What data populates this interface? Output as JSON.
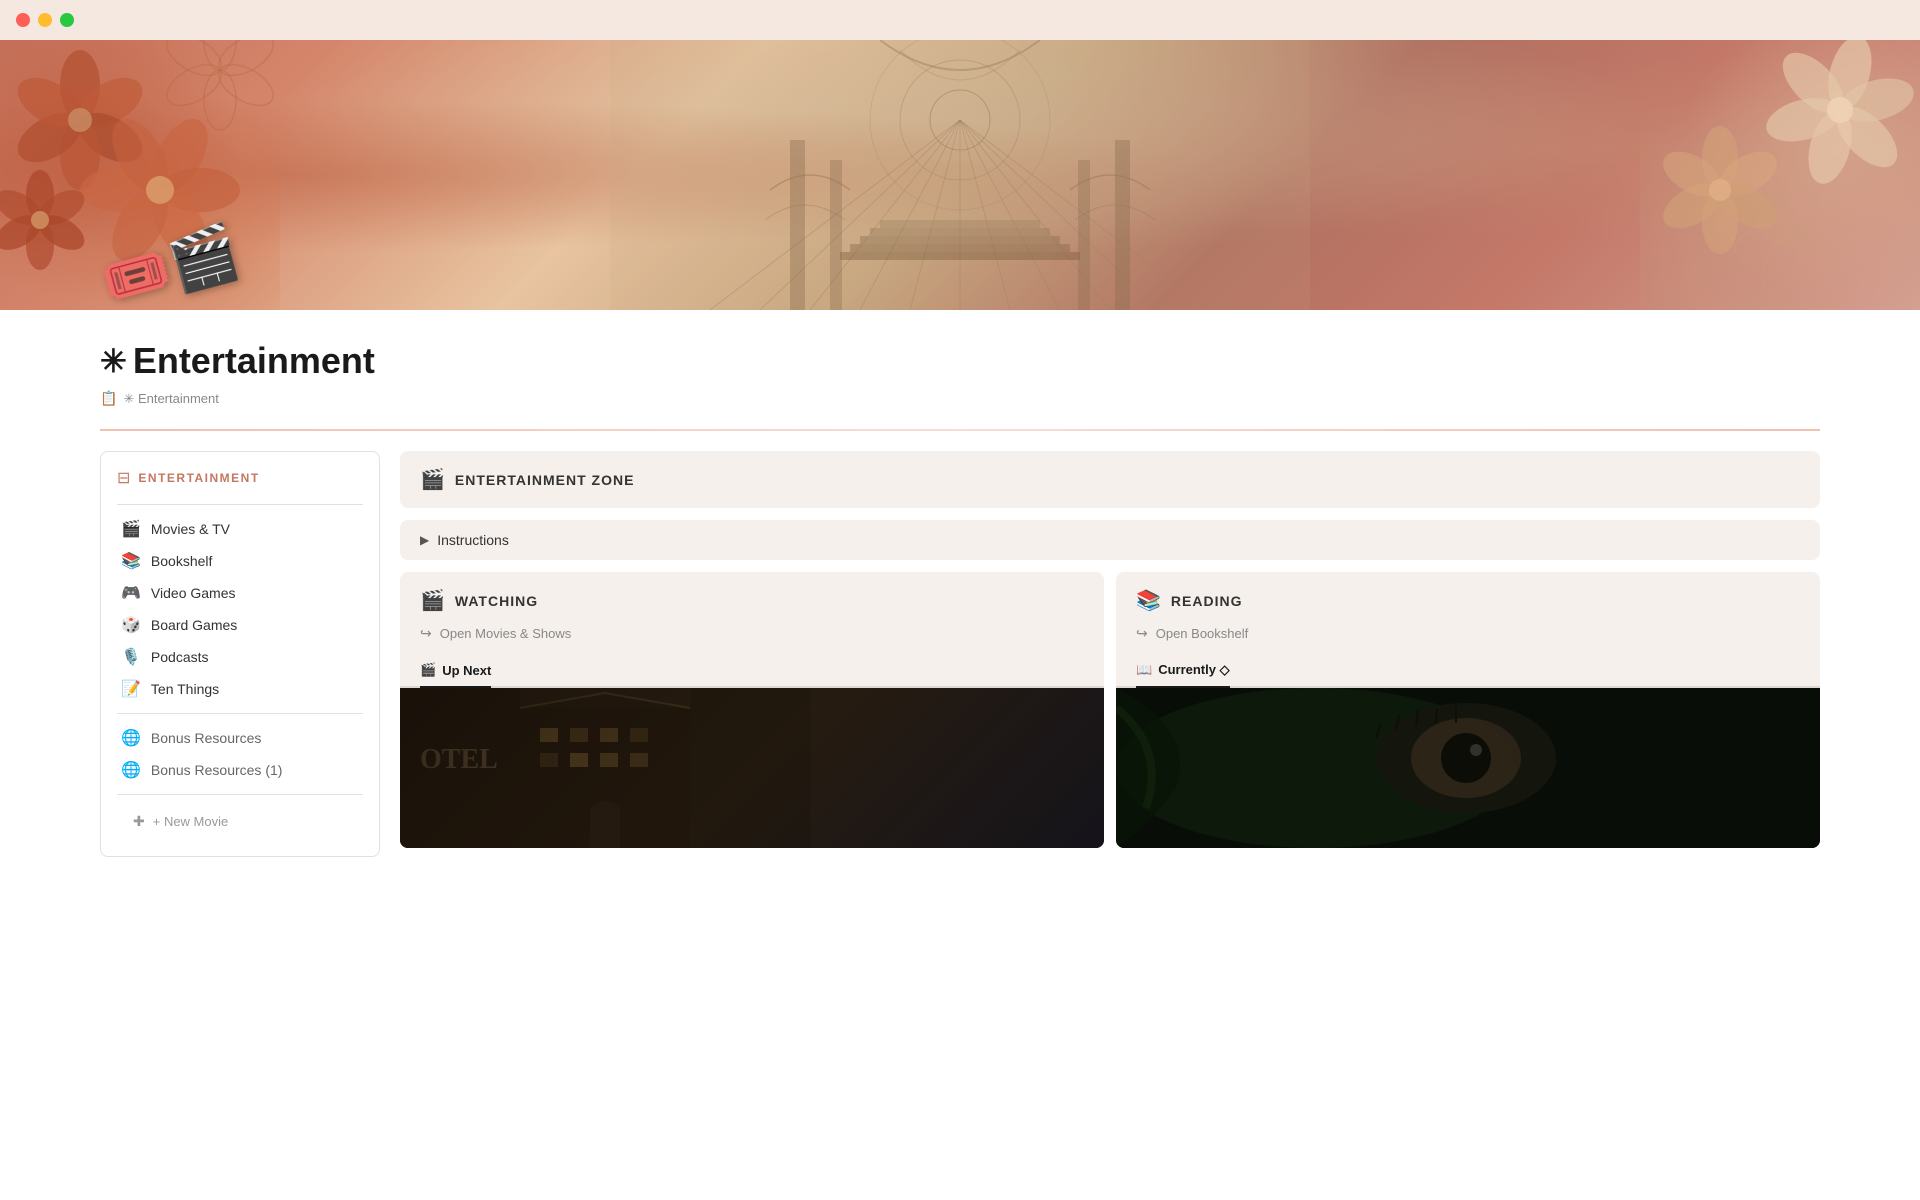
{
  "titleBar": {
    "trafficLights": [
      "red",
      "yellow",
      "green"
    ]
  },
  "hero": {
    "ticketEmoji": "🎟️🎬"
  },
  "page": {
    "icon": "✳",
    "title": "Entertainment",
    "breadcrumb": {
      "icon": "📋",
      "text": "✳ Entertainment"
    }
  },
  "sidebar": {
    "header": {
      "icon": "⊟",
      "title": "ENTERTAINMENT"
    },
    "items": [
      {
        "icon": "🎬",
        "label": "Movies & TV"
      },
      {
        "icon": "📚",
        "label": "Bookshelf"
      },
      {
        "icon": "🎮",
        "label": "Video Games"
      },
      {
        "icon": "🎲",
        "label": "Board Games"
      },
      {
        "icon": "🎙️",
        "label": "Podcasts"
      },
      {
        "icon": "📝",
        "label": "Ten Things"
      }
    ],
    "secondaryItems": [
      {
        "icon": "🌐",
        "label": "Bonus Resources"
      },
      {
        "icon": "🌐",
        "label": "Bonus Resources (1)"
      }
    ],
    "newMovieLabel": "+ New Movie"
  },
  "mainPanel": {
    "zoneHeader": {
      "icon": "🎬",
      "title": "ENTERTAINMENT ZONE"
    },
    "instructions": {
      "arrow": "▶",
      "label": "Instructions"
    },
    "watchingCard": {
      "icon": "🎬",
      "title": "WATCHING",
      "linkArrow": "↪",
      "linkText": "Open Movies & Shows",
      "activeTab": "Up Next",
      "tabs": [
        "Up Next"
      ],
      "tabIcon": "🎬"
    },
    "readingCard": {
      "icon": "📚",
      "title": "READING",
      "linkArrow": "↪",
      "linkText": "Open Bookshelf",
      "activeTab": "Currently ◇",
      "tabs": [
        "Currently ◇"
      ],
      "tabIcon": "📖"
    }
  }
}
